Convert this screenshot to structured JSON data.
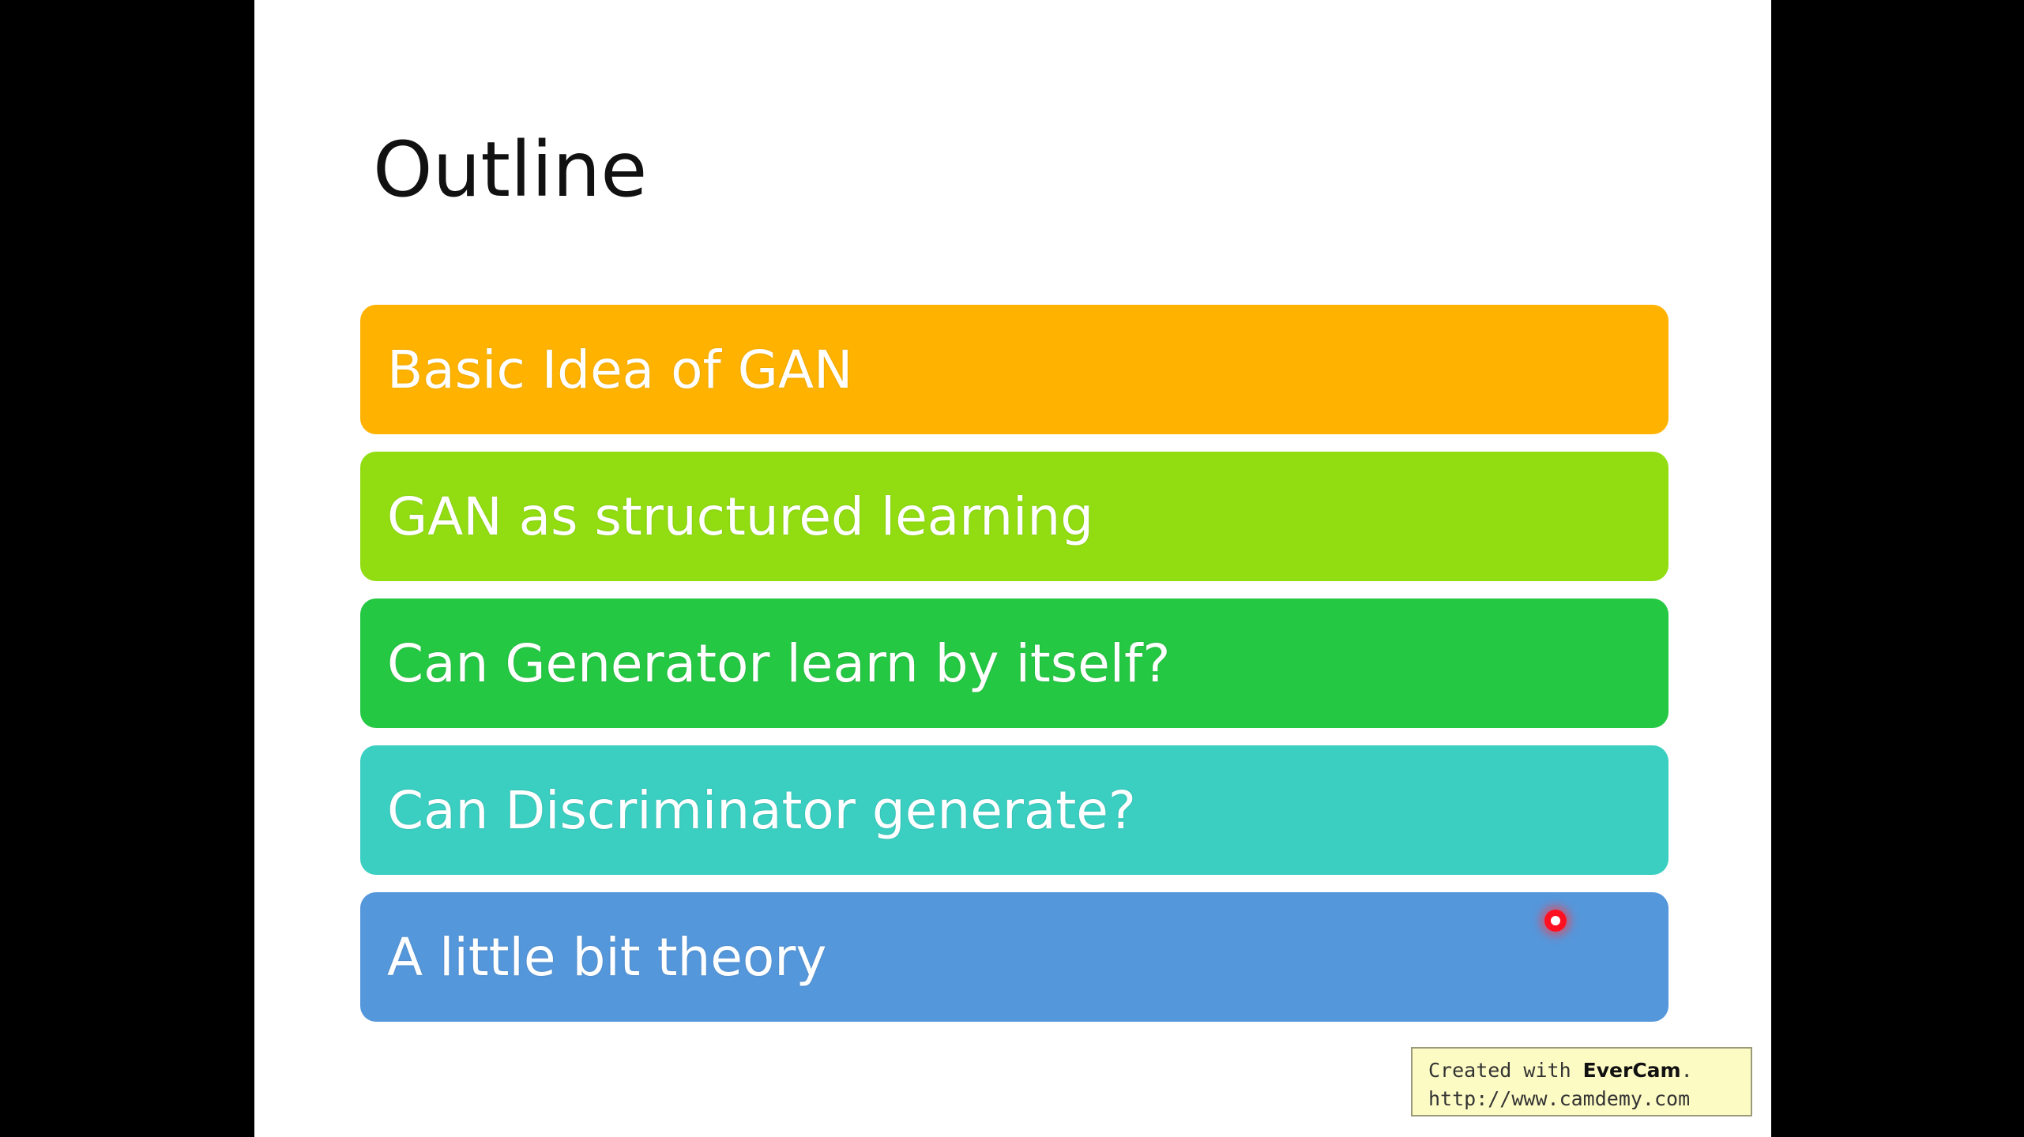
{
  "slide": {
    "title": "Outline",
    "items": [
      {
        "label": "Basic Idea of GAN",
        "color": "#ffb300"
      },
      {
        "label": "GAN as structured learning",
        "color": "#92dd12"
      },
      {
        "label": "Can Generator learn by itself?",
        "color": "#25c843"
      },
      {
        "label": "Can Discriminator generate?",
        "color": "#3bcfc2"
      },
      {
        "label": "A little bit theory",
        "color": "#5597db"
      }
    ]
  },
  "watermark": {
    "prefix": "Created with ",
    "brand": "EverCam",
    "suffix": ".",
    "url": "http://www.camdemy.com"
  },
  "colors": {
    "background": "#000000",
    "slide": "#ffffff",
    "cursor": "#ff1020"
  }
}
